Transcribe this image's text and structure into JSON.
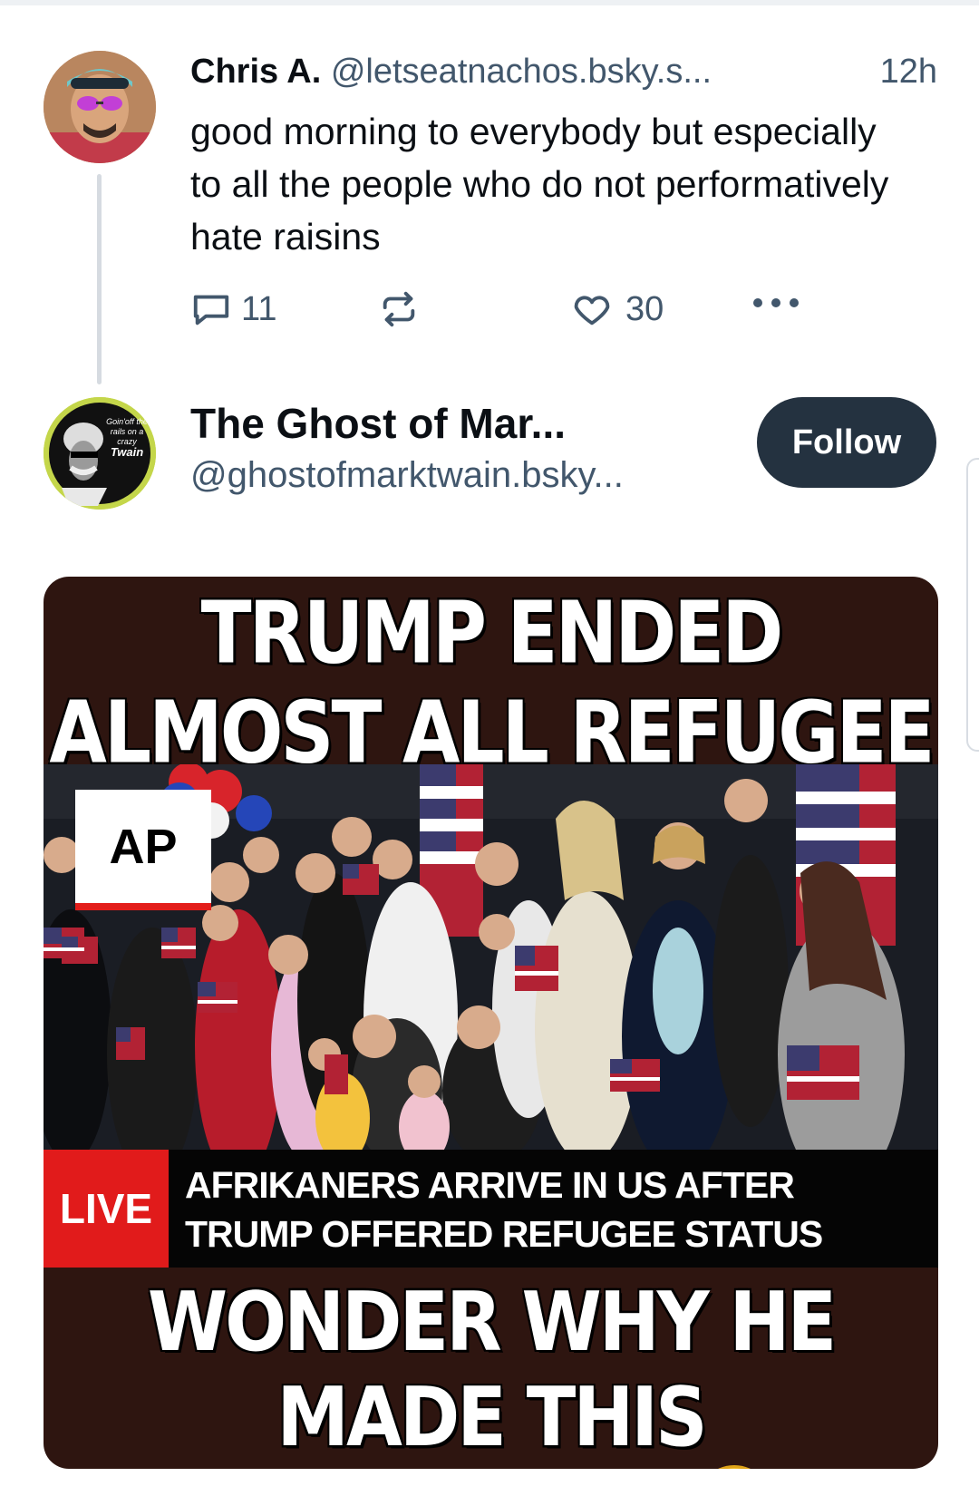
{
  "post1": {
    "author_name": "Chris A.",
    "author_handle": "@letseatnachos.bsky.s...",
    "time": "12h",
    "text": "good morning to everybody but especially to all the people who do not performatively hate raisins",
    "reply_count": "11",
    "like_count": "30"
  },
  "post2": {
    "author_name": "The Ghost of Mar...",
    "author_handle": "@ghostofmarktwain.bsky...",
    "follow_label": "Follow",
    "avatar_text": "Goin' off the rails on a crazy Twain"
  },
  "image": {
    "headline": "TRUMP ENDED ALMOST ALL REFUGEE PROGRAMS",
    "logo_text": "AP",
    "live_label": "LIVE",
    "chyron_line1": "AFRIKANERS ARRIVE IN US AFTER",
    "chyron_line2": "TRUMP OFFERED REFUGEE STATUS",
    "footer": "WONDER WHY HE MADE THIS EXCEPTION?",
    "emoji": "face-with-rolling-eyes"
  },
  "colors": {
    "follow_bg": "#243240",
    "live_red": "#e11b1b",
    "meme_bg": "#2e1510",
    "muted_text": "#42576c"
  }
}
